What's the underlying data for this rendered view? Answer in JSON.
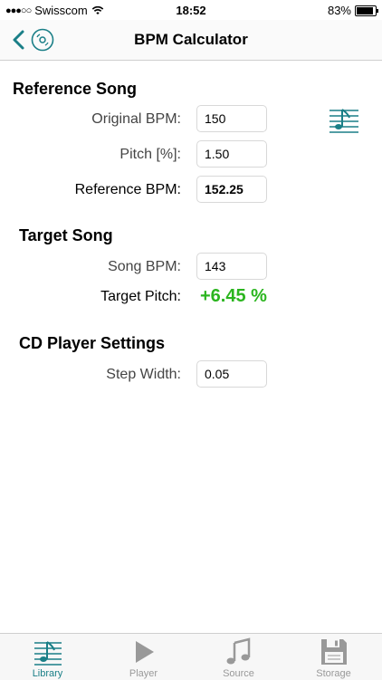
{
  "status": {
    "carrier": "Swisscom",
    "time": "18:52",
    "battery": "83%",
    "battery_level": 0.83
  },
  "nav": {
    "title": "BPM Calculator"
  },
  "reference": {
    "title": "Reference Song",
    "original_bpm_label": "Original BPM:",
    "original_bpm_value": "150",
    "pitch_label": "Pitch [%]:",
    "pitch_value": "1.50",
    "reference_bpm_label": "Reference BPM:",
    "reference_bpm_value": "152.25"
  },
  "target": {
    "title": "Target Song",
    "song_bpm_label": "Song BPM:",
    "song_bpm_value": "143",
    "target_pitch_label": "Target Pitch:",
    "target_pitch_value": "+6.45 %"
  },
  "cd": {
    "title": "CD Player Settings",
    "step_width_label": "Step Width:",
    "step_width_value": "0.05"
  },
  "tabs": [
    {
      "label": "Library",
      "icon": "library-icon",
      "active": true
    },
    {
      "label": "Player",
      "icon": "play-icon",
      "active": false
    },
    {
      "label": "Source",
      "icon": "music-note-icon",
      "active": false
    },
    {
      "label": "Storage",
      "icon": "floppy-disk-icon",
      "active": false
    }
  ],
  "colors": {
    "accent": "#1a7f87",
    "result": "#2bb51f"
  }
}
